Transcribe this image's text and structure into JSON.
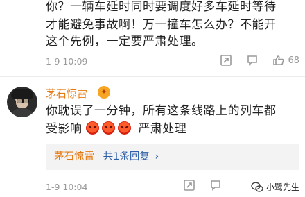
{
  "post1": {
    "lines": [
      "你？一辆车延时同时要调度好多车延时等待",
      "才能避免事故啊！万一撞车怎么办？不能开",
      "这个先例，一定要严肃处理。"
    ],
    "time": "1-9 10:09",
    "like_count": "68",
    "icons": [
      "share-icon",
      "comment-icon",
      "like-icon"
    ]
  },
  "post2": {
    "username": "茅石惊雷",
    "badge_icon": "fire-badge-icon",
    "lines": [
      "你耽误了一分钟，所有这条线路上的列车都"
    ],
    "line2_prefix": "受影响",
    "line2_emojis": [
      "angry-emoji",
      "angry-emoji",
      "angry-emoji"
    ],
    "line2_suffix": "严肃处理",
    "reply": {
      "name": "茅石惊雷",
      "count_text": "共1条回复",
      "chevron": "›"
    },
    "time": "1-9 10:04",
    "icons": [
      "share-icon",
      "comment-icon"
    ]
  },
  "watermark": {
    "text": "小鹭先生"
  }
}
